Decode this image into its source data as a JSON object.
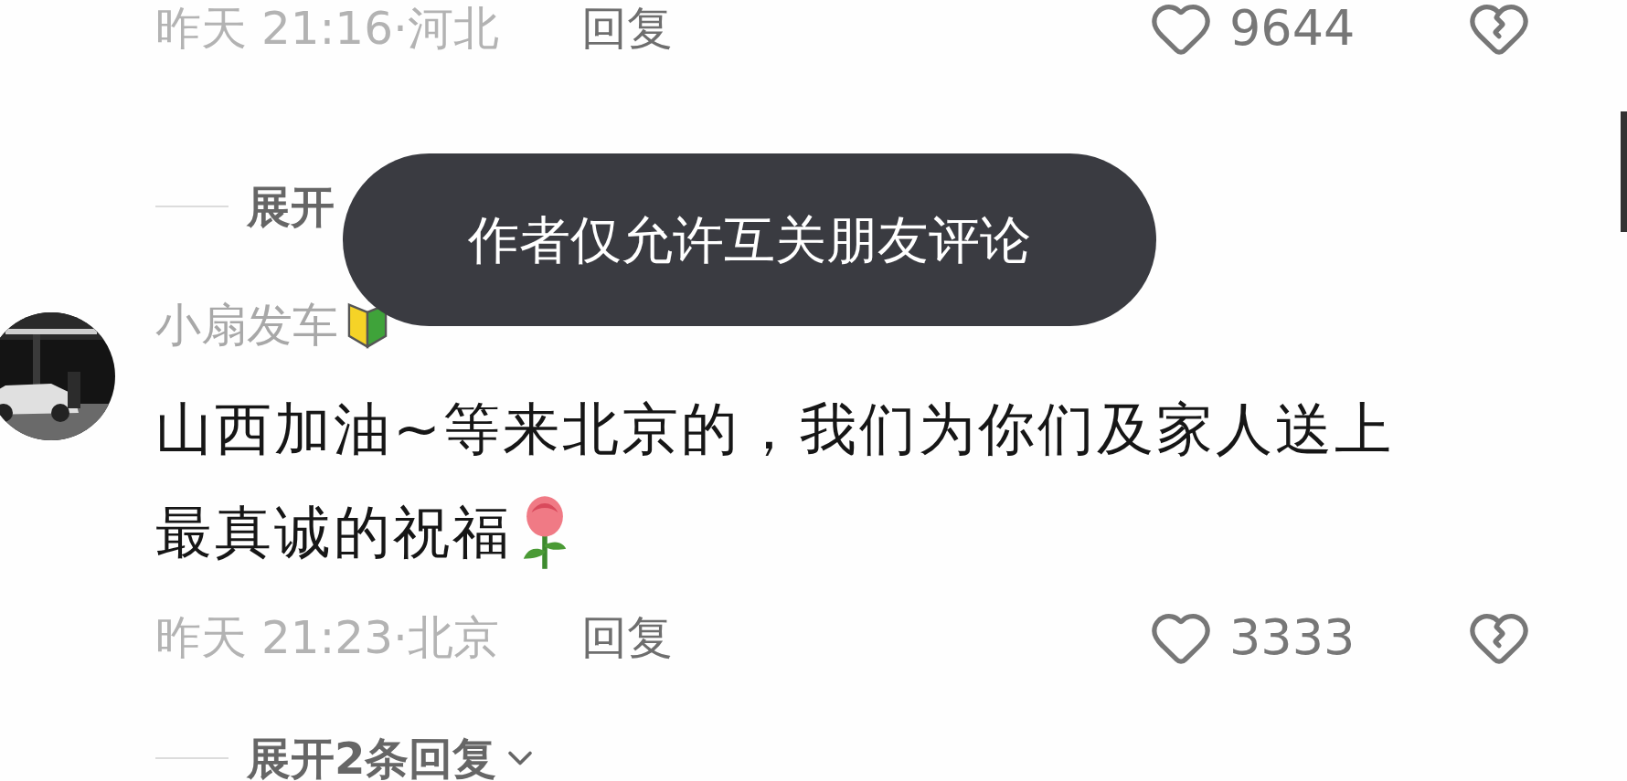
{
  "comments": [
    {
      "meta": "昨天 21:16·河北",
      "reply": "回复",
      "likes": "9644",
      "expand": "展开",
      "chevron": false
    },
    {
      "username": "小扇发车",
      "text_lines": [
        "山西加油~等来北京的，我们为你们及家人送上",
        "最真诚的祝福"
      ],
      "meta": "昨天 21:23·北京",
      "reply": "回复",
      "likes": "3333",
      "expand": "展开2条回复",
      "chevron": true
    }
  ],
  "toast": "作者仅允许互关朋友评论"
}
